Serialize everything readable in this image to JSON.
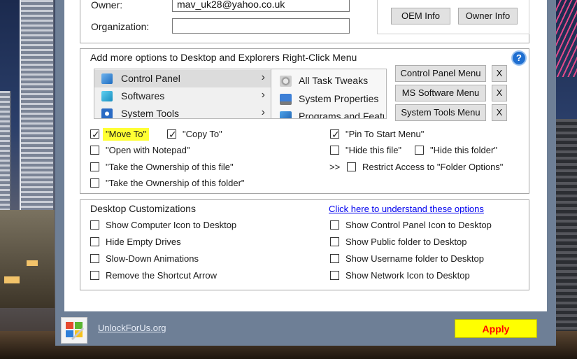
{
  "owner_section": {
    "owner_label": "Owner:",
    "owner_value": "mav_uk28@yahoo.co.uk",
    "organization_label": "Organization:",
    "organization_value": "",
    "oem_info_button": "OEM Info",
    "owner_info_button": "Owner Info"
  },
  "context_menu_section": {
    "title": "Add more options to Desktop and Explorers Right-Click Menu",
    "help_icon": "?",
    "menu_items": [
      {
        "label": "Control Panel",
        "icon": "control-panel-icon",
        "selected": true
      },
      {
        "label": "Softwares",
        "icon": "softwares-icon",
        "selected": false
      },
      {
        "label": "System Tools",
        "icon": "system-tools-icon",
        "selected": false
      }
    ],
    "submenu_items": [
      {
        "label": "All Task Tweaks",
        "icon": "gears-icon"
      },
      {
        "label": "System Properties",
        "icon": "system-properties-icon"
      },
      {
        "label": "Programs and Featu",
        "icon": "programs-icon"
      }
    ],
    "menu_buttons": [
      {
        "label": "Control Panel Menu",
        "remove": "X"
      },
      {
        "label": "MS Software Menu",
        "remove": "X"
      },
      {
        "label": "System Tools Menu",
        "remove": "X"
      }
    ],
    "options": {
      "move_to": {
        "label": "\"Move To\"",
        "checked": true
      },
      "copy_to": {
        "label": "\"Copy To\"",
        "checked": true
      },
      "pin_to_start": {
        "label": "\"Pin To Start Menu\"",
        "checked": true
      },
      "open_with_notepad": {
        "label": "\"Open with Notepad\"",
        "checked": false
      },
      "hide_this_file": {
        "label": "\"Hide this file\"",
        "checked": false
      },
      "hide_this_folder": {
        "label": "\"Hide this folder\"",
        "checked": false
      },
      "take_ownership_file": {
        "label": "\"Take the Ownership of this file\"",
        "checked": false
      },
      "restrict_prefix": ">>",
      "restrict_access": {
        "label": "Restrict Access to \"Folder Options\"",
        "checked": false
      },
      "take_ownership_folder": {
        "label": "\"Take the Ownership of this folder\"",
        "checked": false
      }
    }
  },
  "desktop_section": {
    "title": "Desktop Customizations",
    "help_link": "Click here to understand these options",
    "left_options": [
      {
        "label": "Show Computer Icon to Desktop",
        "checked": false
      },
      {
        "label": "Hide Empty Drives",
        "checked": false
      },
      {
        "label": "Slow-Down Animations",
        "checked": false
      },
      {
        "label": "Remove the Shortcut Arrow",
        "checked": false
      }
    ],
    "right_options": [
      {
        "label": "Show Control Panel Icon to Desktop",
        "checked": false
      },
      {
        "label": "Show Public folder to Desktop",
        "checked": false
      },
      {
        "label": "Show Username folder to Desktop",
        "checked": false
      },
      {
        "label": "Show Network Icon to Desktop",
        "checked": false
      }
    ]
  },
  "footer": {
    "site_link": "UnlockForUs.org",
    "apply_button": "Apply"
  },
  "check_glyph": "✓"
}
